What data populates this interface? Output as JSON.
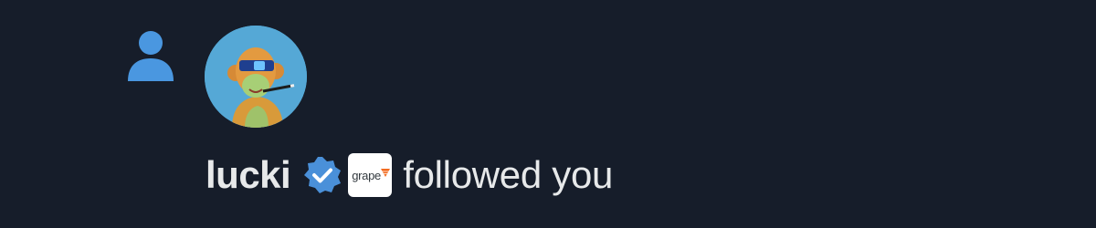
{
  "notification": {
    "type_icon": "person-icon",
    "avatar_icon": "ape-avatar-icon",
    "user_name": "lucki",
    "verified_icon": "verified-badge-icon",
    "affiliate_badge_text": "grape",
    "affiliate_badge_icon": "grape-logo-icon",
    "action_text": "followed you"
  },
  "colors": {
    "background": "#161d2a",
    "icon_blue": "#1d9bf0",
    "text_primary": "#e7e9ea",
    "badge_orange": "#f26b21"
  }
}
